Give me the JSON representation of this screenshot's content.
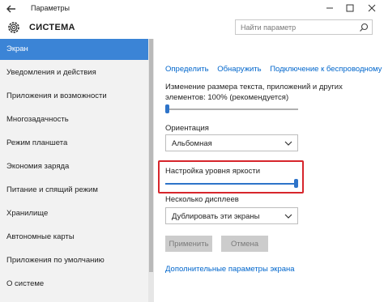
{
  "window": {
    "title": "Параметры",
    "icons": {
      "back": "back-arrow-icon",
      "minimize": "minimize-icon",
      "maximize": "maximize-icon",
      "close": "close-icon"
    }
  },
  "header": {
    "app_title": "СИСТЕМА",
    "icon": "gear-icon",
    "search": {
      "placeholder": "Найти параметр",
      "icon": "search-icon"
    }
  },
  "sidebar": {
    "items": [
      {
        "label": "Экран",
        "active": true
      },
      {
        "label": "Уведомления и действия"
      },
      {
        "label": "Приложения и возможности"
      },
      {
        "label": "Многозадачность"
      },
      {
        "label": "Режим планшета"
      },
      {
        "label": "Экономия заряда"
      },
      {
        "label": "Питание и спящий режим"
      },
      {
        "label": "Хранилище"
      },
      {
        "label": "Автономные карты"
      },
      {
        "label": "Приложения по умолчанию"
      },
      {
        "label": "О системе"
      }
    ]
  },
  "main": {
    "links": [
      "Определить",
      "Обнаружить",
      "Подключение к беспроводному"
    ],
    "scale": {
      "label_line1": "Изменение размера текста, приложений и других",
      "label_line2": "элементов: 100% (рекомендуется)",
      "value": 0.0
    },
    "orientation": {
      "label": "Ориентация",
      "value": "Альбомная"
    },
    "brightness": {
      "label": "Настройка уровня яркости",
      "value": 1.0
    },
    "multiple_displays": {
      "label": "Несколько дисплеев",
      "value": "Дублировать эти экраны"
    },
    "buttons": {
      "apply": "Применить",
      "cancel": "Отмена"
    },
    "advanced_link": "Дополнительные параметры экрана"
  },
  "colors": {
    "accent": "#3b84d6",
    "link": "#0066cc",
    "highlight_border": "#d7262c",
    "sidebar_bg": "#f2f2f2"
  }
}
